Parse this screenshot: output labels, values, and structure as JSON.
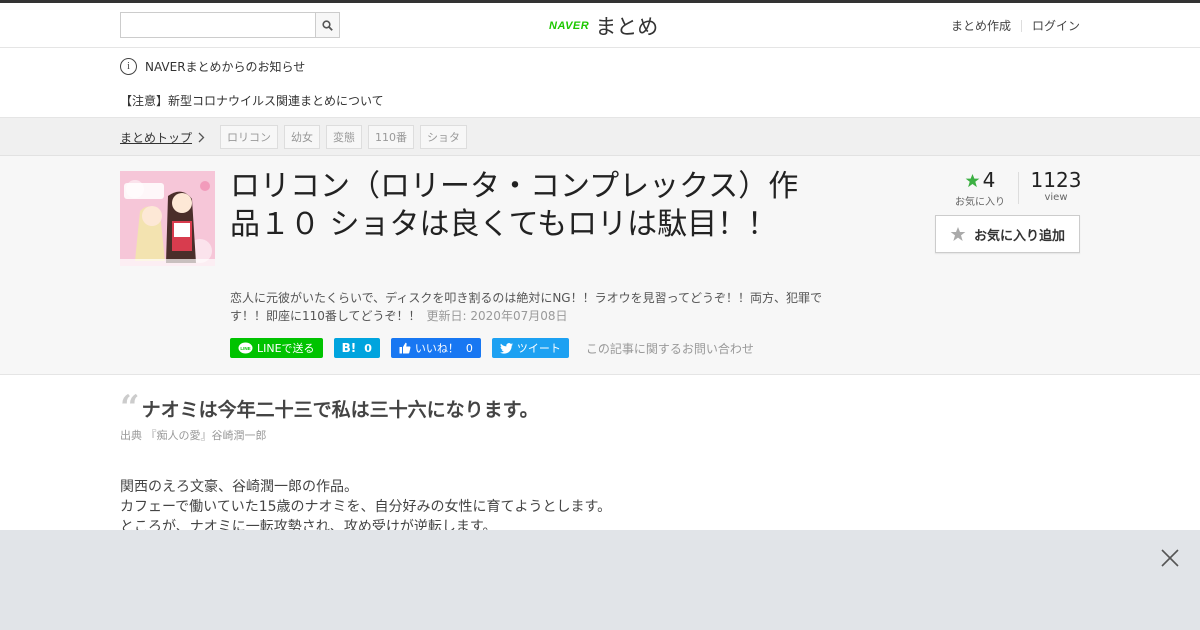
{
  "header": {
    "search_placeholder": "",
    "logo_naver": "NAVER",
    "logo_matome": "まとめ",
    "nav": [
      "まとめ作成",
      "ログイン"
    ]
  },
  "notice": {
    "title": "NAVERまとめからのお知らせ",
    "item": "【注意】新型コロナウイルス関連まとめについて"
  },
  "breadcrumb": {
    "home": "まとめトップ",
    "tags": [
      "ロリコン",
      "幼女",
      "変態",
      "110番",
      "ショタ"
    ]
  },
  "article": {
    "title": "ロリコン（ロリータ・コンプレックス）作品１０ ショタは良くてもロリは駄目！！",
    "description": "恋人に元彼がいたくらいで、ディスクを叩き割るのは絶対にNG！！ラオウを見習ってどうぞ！！両方、犯罪です！！即座に110番してどうぞ！！",
    "updated": "更新日: 2020年07月08日",
    "favorites_count": "4",
    "favorites_label": "お気に入り",
    "views_count": "1123",
    "views_label": "view",
    "favorite_button": "お気に入り追加"
  },
  "share": {
    "line": "LINEで送る",
    "hatena_count": "0",
    "fb_label": "いいね！",
    "fb_count": "0",
    "tweet": "ツイート",
    "inquiry": "この記事に関するお問い合わせ"
  },
  "content": {
    "quote": "ナオミは今年二十三で私は三十六になります。",
    "source": "出典 『痴人の愛』谷崎潤一郎",
    "paragraphs": [
      "関西のえろ文豪、谷崎潤一郎の作品。",
      "カフェーで働いていた15歳のナオミを、自分好みの女性に育てようとします。",
      "ところが、ナオミに一転攻勢され、攻め受けが逆転します。"
    ]
  },
  "colors": {
    "naver_green": "#1ec800",
    "line_green": "#00c300",
    "hatena_blue": "#00a4de",
    "facebook_blue": "#1877f2",
    "twitter_blue": "#1da1f2",
    "star_green": "#3cb043"
  }
}
